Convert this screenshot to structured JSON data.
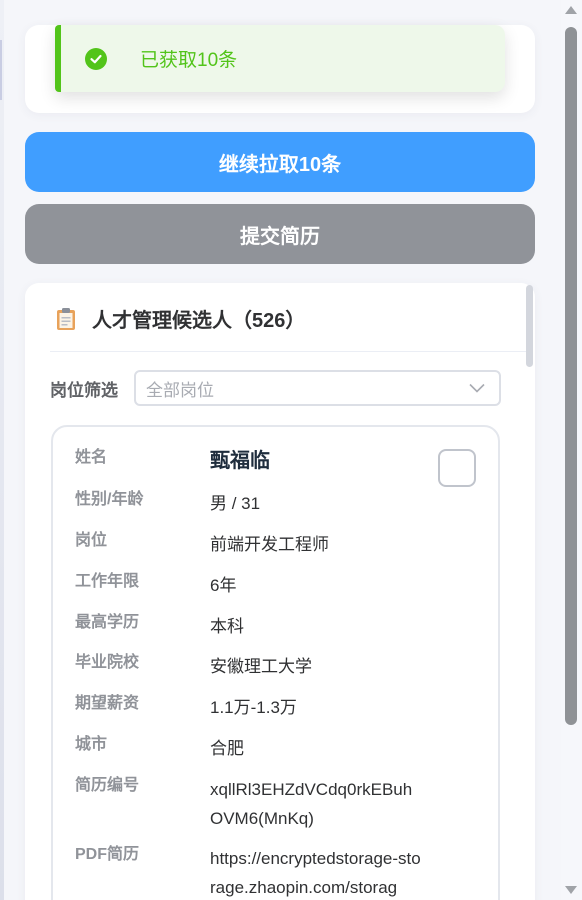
{
  "toast": {
    "text": "已获取10条",
    "icon": "check-circle-icon",
    "color": "#52c41a"
  },
  "actions": {
    "continue_label": "继续拉取10条",
    "submit_label": "提交简历",
    "continue_color": "#409eff",
    "submit_color": "#909399"
  },
  "panel": {
    "title": "人才管理候选人（526）",
    "icon": "clipboard-icon",
    "filter": {
      "label": "岗位筛选",
      "placeholder": "全部岗位"
    }
  },
  "candidate": {
    "fields": [
      {
        "key": "姓名",
        "value": "甄福临"
      },
      {
        "key": "性别/年龄",
        "value": "男 / 31"
      },
      {
        "key": "岗位",
        "value": "前端开发工程师"
      },
      {
        "key": "工作年限",
        "value": "6年"
      },
      {
        "key": "最高学历",
        "value": "本科"
      },
      {
        "key": "毕业院校",
        "value": "安徽理工大学"
      },
      {
        "key": "期望薪资",
        "value": "1.1万-1.3万"
      },
      {
        "key": "城市",
        "value": "合肥"
      },
      {
        "key": "简历编号",
        "value": "xqllRl3EHZdVCdq0rkEBuhOVM6(MnKq)"
      },
      {
        "key": "PDF简历",
        "value": "https://encryptedstorage-storage.zhaopin.com/storag"
      }
    ]
  }
}
